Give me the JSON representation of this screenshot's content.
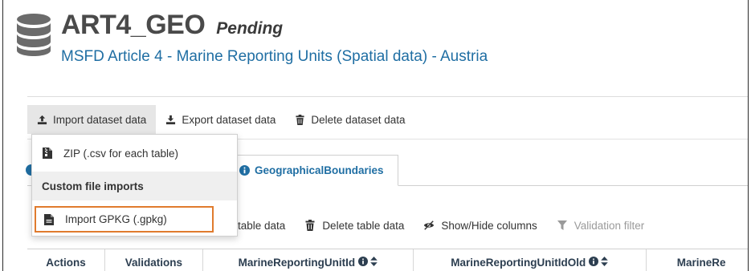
{
  "header": {
    "title": "ART4_GEO",
    "status": "Pending",
    "subtitle": "MSFD Article 4 - Marine Reporting Units (Spatial data) - Austria"
  },
  "toolbar": {
    "import_label": "Import dataset data",
    "export_label": "Export dataset data",
    "delete_label": "Delete dataset data"
  },
  "dropdown": {
    "zip_label": "ZIP (.csv for each table)",
    "section_header": "Custom file imports",
    "gpkg_label": "Import GPKG (.gpkg)"
  },
  "tabs": {
    "active_label": "GeographicalBoundaries"
  },
  "table_toolbar": {
    "import_partial": "table data",
    "delete_label": "Delete table data",
    "show_hide_label": "Show/Hide columns",
    "validation_filter_label": "Validation filter"
  },
  "table": {
    "columns": [
      "Actions",
      "Validations",
      "MarineReportingUnitId",
      "MarineReportingUnitIdOld",
      "MarineRe"
    ]
  },
  "colors": {
    "link_blue": "#1f6ea3",
    "highlight_orange": "#e07b2e",
    "active_bg": "#e6e6e6"
  },
  "icons": [
    "database-icon",
    "upload-icon",
    "download-icon",
    "trash-icon",
    "file-zip-icon",
    "file-icon",
    "info-icon",
    "eye-slash-icon",
    "filter-icon",
    "sort-icon"
  ]
}
